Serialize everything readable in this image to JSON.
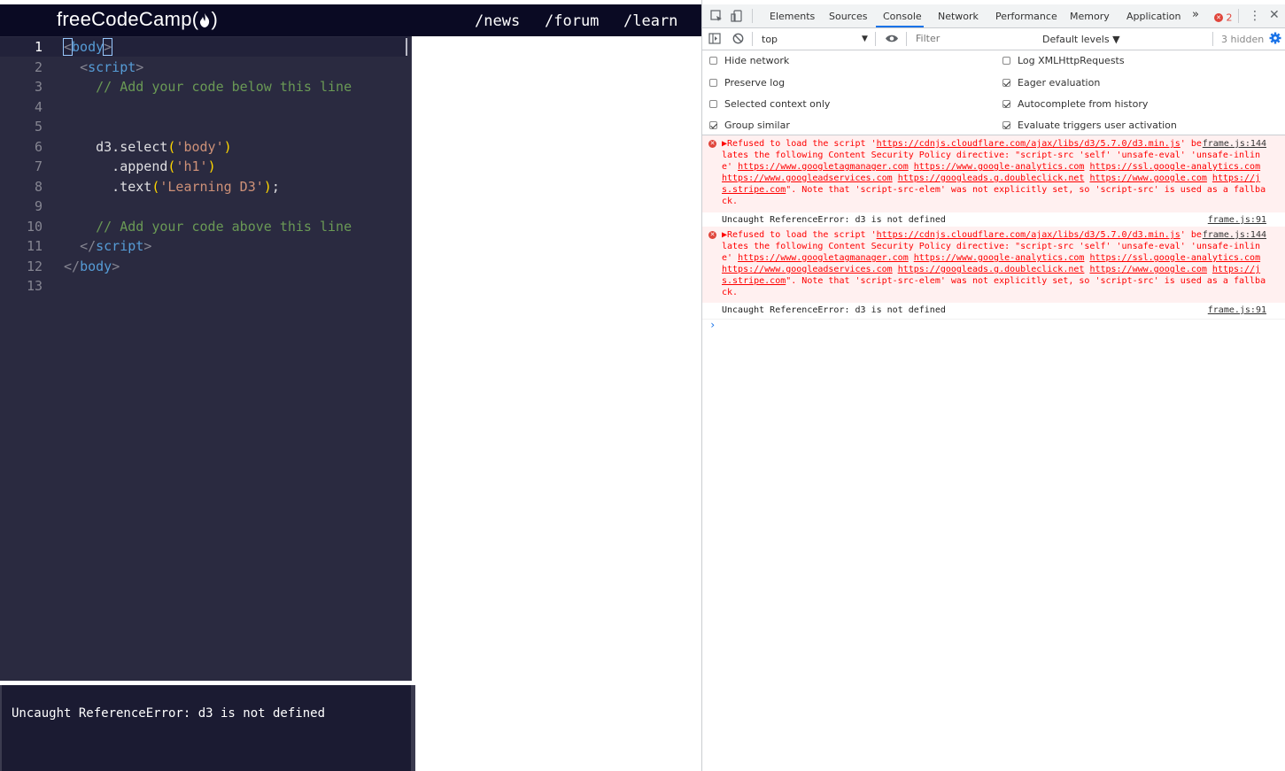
{
  "fcc": {
    "logo_text": "freeCodeCamp",
    "nav_links": [
      "/news",
      "/forum",
      "/learn"
    ],
    "editor_lines": [
      {
        "num": "1",
        "tokens": [
          {
            "cls": "bracket bx",
            "t": "<"
          },
          {
            "cls": "tag",
            "t": "body"
          },
          {
            "cls": "bracket bx",
            "t": ">"
          }
        ]
      },
      {
        "num": "2",
        "tokens": [
          {
            "cls": "plain",
            "t": "  "
          },
          {
            "cls": "bracket",
            "t": "<"
          },
          {
            "cls": "tag",
            "t": "script"
          },
          {
            "cls": "bracket",
            "t": ">"
          }
        ]
      },
      {
        "num": "3",
        "tokens": [
          {
            "cls": "cmt",
            "t": "    // Add your code below this line"
          }
        ]
      },
      {
        "num": "4",
        "tokens": []
      },
      {
        "num": "5",
        "tokens": []
      },
      {
        "num": "6",
        "tokens": [
          {
            "cls": "plain",
            "t": "    d3.select"
          },
          {
            "cls": "paren-y",
            "t": "("
          },
          {
            "cls": "str",
            "t": "'body'"
          },
          {
            "cls": "paren-y",
            "t": ")"
          }
        ]
      },
      {
        "num": "7",
        "tokens": [
          {
            "cls": "plain",
            "t": "      .append"
          },
          {
            "cls": "paren-y",
            "t": "("
          },
          {
            "cls": "str",
            "t": "'h1'"
          },
          {
            "cls": "paren-y",
            "t": ")"
          }
        ]
      },
      {
        "num": "8",
        "tokens": [
          {
            "cls": "plain",
            "t": "      .text"
          },
          {
            "cls": "paren-y",
            "t": "("
          },
          {
            "cls": "str",
            "t": "'Learning D3'"
          },
          {
            "cls": "paren-y",
            "t": ")"
          },
          {
            "cls": "plain",
            "t": ";"
          }
        ]
      },
      {
        "num": "9",
        "tokens": []
      },
      {
        "num": "10",
        "tokens": [
          {
            "cls": "cmt",
            "t": "    // Add your code above this line"
          }
        ]
      },
      {
        "num": "11",
        "tokens": [
          {
            "cls": "plain",
            "t": "  "
          },
          {
            "cls": "bracket",
            "t": "</"
          },
          {
            "cls": "tag",
            "t": "script"
          },
          {
            "cls": "bracket",
            "t": ">"
          }
        ]
      },
      {
        "num": "12",
        "tokens": [
          {
            "cls": "bracket",
            "t": "</"
          },
          {
            "cls": "tag",
            "t": "body"
          },
          {
            "cls": "bracket",
            "t": ">"
          }
        ]
      },
      {
        "num": "13",
        "tokens": []
      }
    ],
    "output_text": "Uncaught ReferenceError: d3 is not defined"
  },
  "devtools": {
    "tabs": [
      "Elements",
      "Sources",
      "Console",
      "Network",
      "Performance",
      "Memory",
      "Application"
    ],
    "active_tab": "Console",
    "more_tabs": "»",
    "error_count": "2",
    "toolbar": {
      "context": "top",
      "filter_placeholder": "Filter",
      "levels": "Default levels ▼",
      "hidden": "3 hidden"
    },
    "settings_left": [
      {
        "label": "Hide network",
        "checked": false
      },
      {
        "label": "Preserve log",
        "checked": false
      },
      {
        "label": "Selected context only",
        "checked": false
      },
      {
        "label": "Group similar",
        "checked": true
      }
    ],
    "settings_right": [
      {
        "label": "Log XMLHttpRequests",
        "checked": false
      },
      {
        "label": "Eager evaluation",
        "checked": true
      },
      {
        "label": "Autocomplete from history",
        "checked": true
      },
      {
        "label": "Evaluate triggers user activation",
        "checked": true
      }
    ],
    "messages": [
      {
        "type": "error",
        "text_parts": [
          {
            "t": "▶Refused to load the script '"
          },
          {
            "t": "https://cdnjs.cloudflare.com/ajax/libs/d3/5.7.0/d3.min.js",
            "link": true
          },
          {
            "t": "' because it violates the following Content Security Policy directive: \"script-src 'self' 'unsafe-eval' 'unsafe-inline' "
          },
          {
            "t": "https://www.googletagmanager.com",
            "link": true
          },
          {
            "t": " "
          },
          {
            "t": "https://www.google-analytics.com",
            "link": true
          },
          {
            "t": " "
          },
          {
            "t": "https://ssl.google-analytics.com",
            "link": true
          },
          {
            "t": " "
          },
          {
            "t": "https://www.googleadservices.com",
            "link": true
          },
          {
            "t": " "
          },
          {
            "t": "https://googleads.g.doubleclick.net",
            "link": true
          },
          {
            "t": " "
          },
          {
            "t": "https://www.google.com",
            "link": true
          },
          {
            "t": " "
          },
          {
            "t": "https://js.stripe.com",
            "link": true
          },
          {
            "t": "\". Note that 'script-src-elem' was not explicitly set, so 'script-src' is used as a fallback."
          }
        ],
        "source": "frame.js:144"
      },
      {
        "type": "plain",
        "text": "Uncaught ReferenceError: d3 is not defined",
        "source": "frame.js:91"
      },
      {
        "type": "error",
        "text_parts": [
          {
            "t": "▶Refused to load the script '"
          },
          {
            "t": "https://cdnjs.cloudflare.com/ajax/libs/d3/5.7.0/d3.min.js",
            "link": true
          },
          {
            "t": "' because it violates the following Content Security Policy directive: \"script-src 'self' 'unsafe-eval' 'unsafe-inline' "
          },
          {
            "t": "https://www.googletagmanager.com",
            "link": true
          },
          {
            "t": " "
          },
          {
            "t": "https://www.google-analytics.com",
            "link": true
          },
          {
            "t": " "
          },
          {
            "t": "https://ssl.google-analytics.com",
            "link": true
          },
          {
            "t": " "
          },
          {
            "t": "https://www.googleadservices.com",
            "link": true
          },
          {
            "t": " "
          },
          {
            "t": "https://googleads.g.doubleclick.net",
            "link": true
          },
          {
            "t": " "
          },
          {
            "t": "https://www.google.com",
            "link": true
          },
          {
            "t": " "
          },
          {
            "t": "https://js.stripe.com",
            "link": true
          },
          {
            "t": "\". Note that 'script-src-elem' was not explicitly set, so 'script-src' is used as a fallback."
          }
        ],
        "source": "frame.js:144"
      },
      {
        "type": "plain",
        "text": "Uncaught ReferenceError: d3 is not defined",
        "source": "frame.js:91"
      }
    ],
    "prompt_symbol": "›",
    "colors": {
      "error_text": "#fe0000",
      "error_bg": "#fff0f0",
      "accent": "#1a73e8"
    }
  }
}
